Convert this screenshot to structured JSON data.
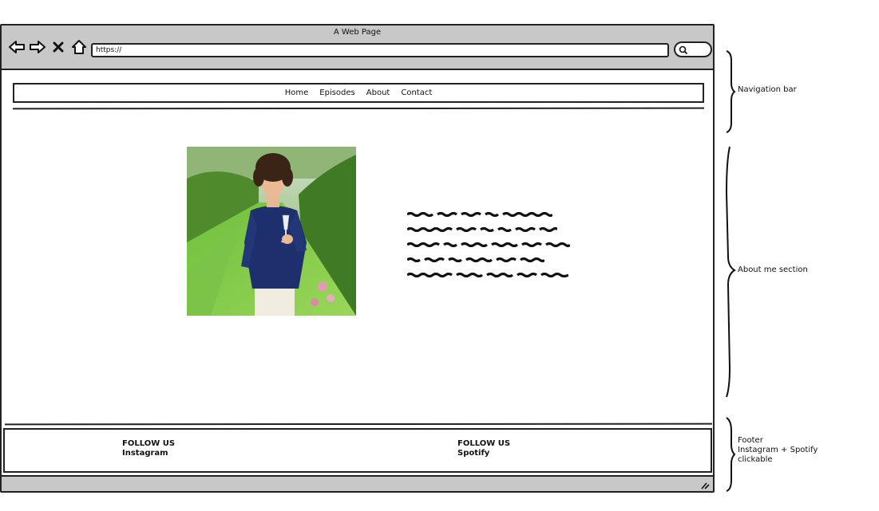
{
  "browser": {
    "title": "A Web Page",
    "url": "https://",
    "icons": [
      "back-arrow-icon",
      "forward-arrow-icon",
      "close-x-icon",
      "home-icon",
      "search-icon",
      "resize-grip-icon"
    ]
  },
  "navbar": {
    "items": [
      {
        "label": "Home"
      },
      {
        "label": "Episodes"
      },
      {
        "label": "About"
      },
      {
        "label": "Contact"
      }
    ]
  },
  "about": {
    "text_lines": 5
  },
  "footer": {
    "left": {
      "heading": "FOLLOW US",
      "link": "Instagram"
    },
    "right": {
      "heading": "FOLLOW US",
      "link": "Spotify"
    }
  },
  "annotations": {
    "nav": "Navigation bar",
    "about": "About me section",
    "footer_line1": "Footer",
    "footer_line2": "Instagram + Spotify",
    "footer_line3": "clickable"
  }
}
